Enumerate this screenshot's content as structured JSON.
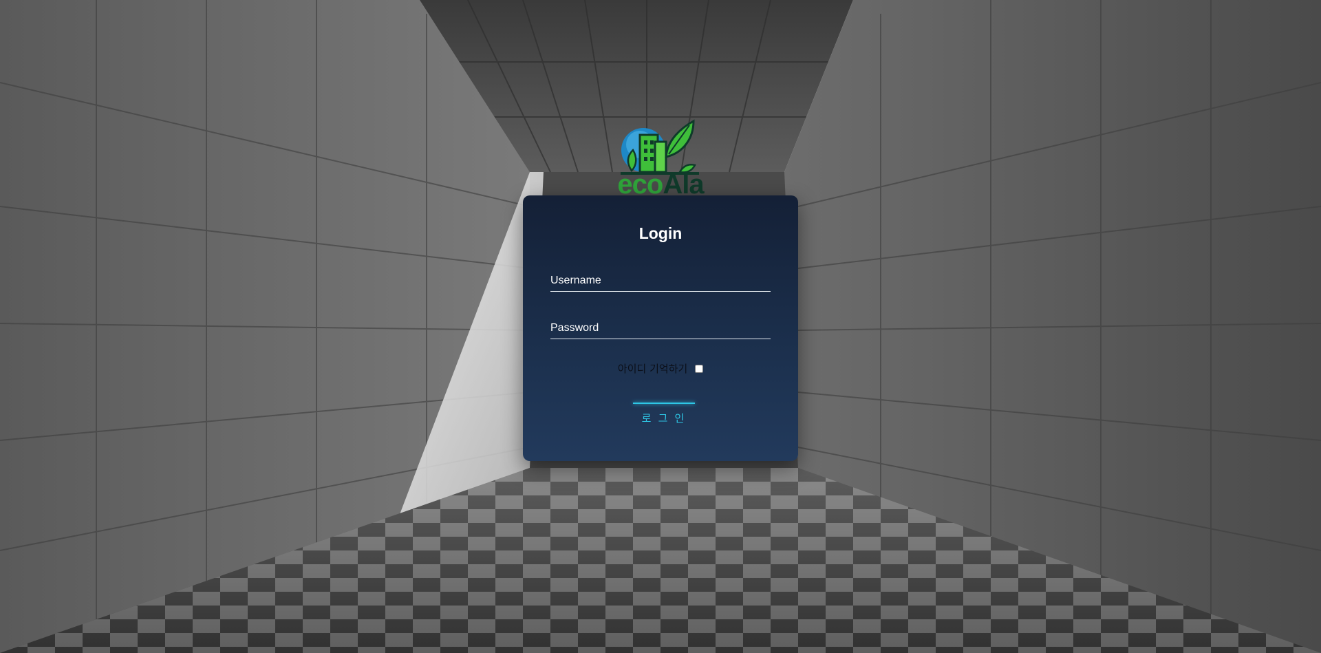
{
  "brand": {
    "logo_part1": "eco",
    "logo_part2": "Ala",
    "colors": {
      "eco": "#2fa33a",
      "ala": "#0f3a2a",
      "building": "#3fbf3a",
      "sky": "#1e88c7"
    }
  },
  "login": {
    "title": "Login",
    "username": {
      "label": "Username",
      "value": ""
    },
    "password": {
      "label": "Password",
      "value": ""
    },
    "remember_label": "아이디 기억하기",
    "remember_checked": false,
    "submit_label": "로 그 인"
  },
  "theme": {
    "card_top": "#142036",
    "card_bottom": "#223a5c",
    "accent": "#2ec7e6",
    "text": "#ffffff"
  }
}
